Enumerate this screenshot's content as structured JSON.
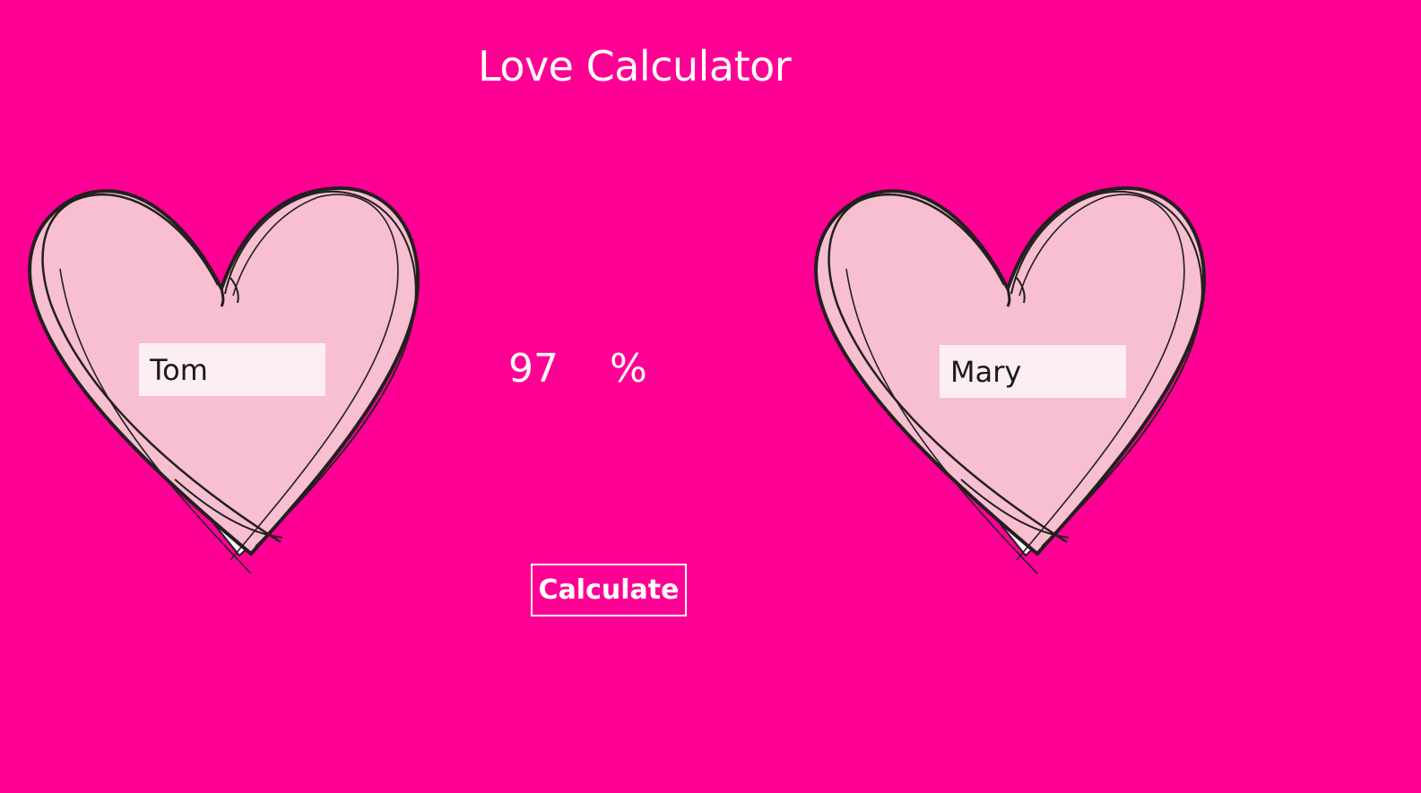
{
  "title": "Love Calculator",
  "left_heart": {
    "name_value": "Tom"
  },
  "right_heart": {
    "name_value": "Mary"
  },
  "result": {
    "value": "97",
    "unit": "%"
  },
  "calculate_button": {
    "label": "Calculate"
  },
  "colors": {
    "background": "#FF0095",
    "heart_fill": "#F7BFD0",
    "heart_stroke": "#231F20",
    "input_background": "#FDEEF3",
    "text_light": "#FFFFFF"
  },
  "icons": {
    "left_heart": "heart-icon",
    "right_heart": "heart-icon"
  }
}
